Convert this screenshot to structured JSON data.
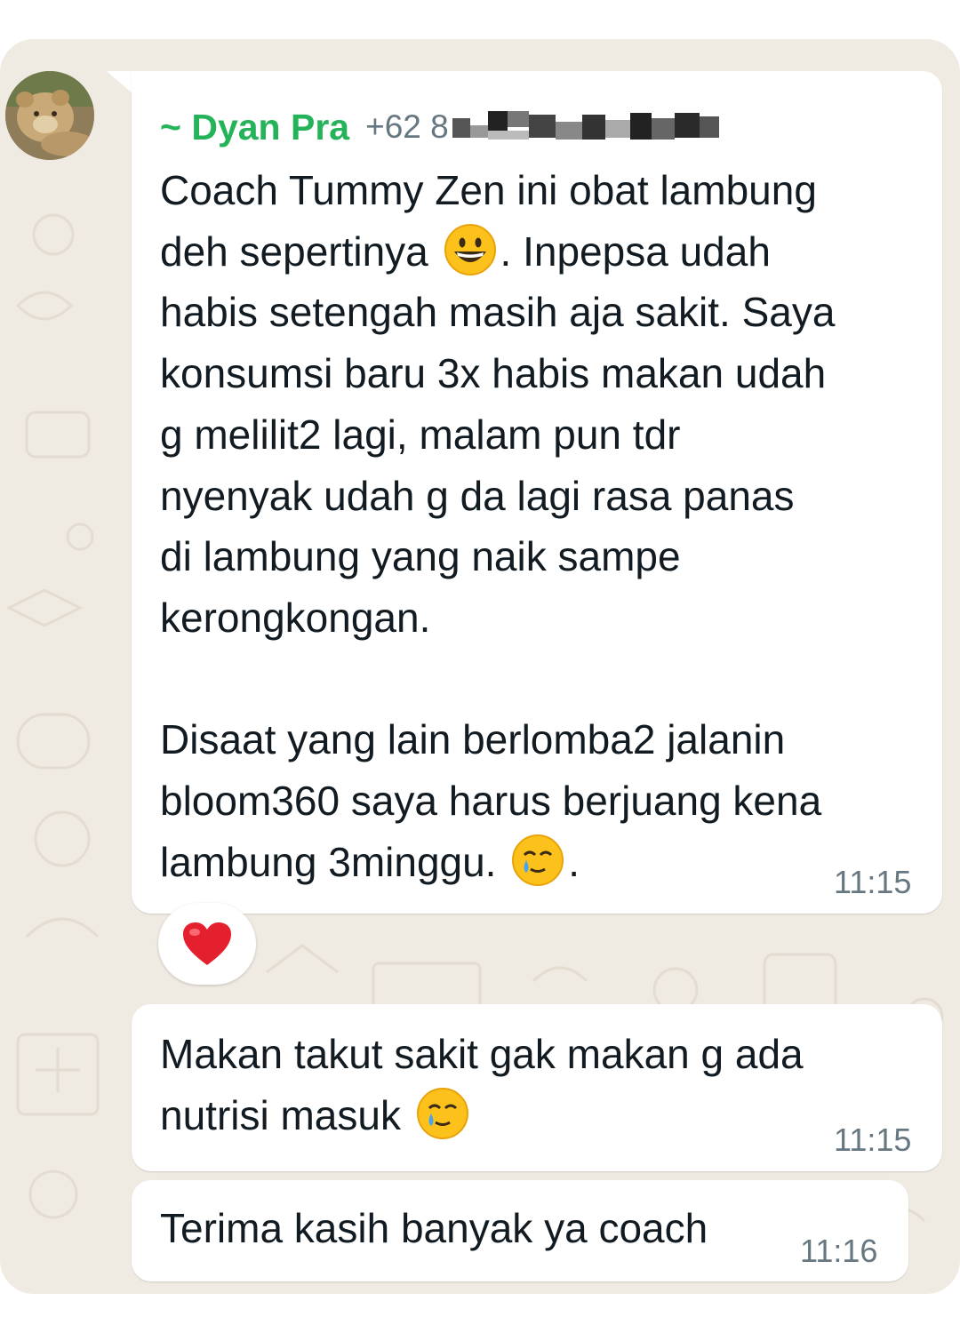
{
  "chat": {
    "message_1": {
      "sender_name": "~ Dyan Pra",
      "sender_phone": "+62 8",
      "text_part_1": "Coach Tummy Zen ini obat lambung\ndeh sepertinya ",
      "emoji_1": "grinning-face-emoji",
      "text_part_2": ". Inpepsa udah\nhabis setengah masih aja sakit. Saya\nkonsumsi baru 3x habis makan udah\ng melilit2 lagi, malam pun tdr\nnyenyak udah g da lagi rasa panas\ndi lambung yang naik sampe\nkerongkongan.\n\nDisaat yang lain berlomba2 jalanin\nbloom360 saya harus berjuang kena\nlambung 3minggu. ",
      "emoji_2": "smiling-face-with-tear-emoji",
      "text_part_3": ".",
      "time": "11:15",
      "reaction": "red-heart-emoji"
    },
    "message_2": {
      "text": "Makan takut sakit gak makan g ada\nnutrisi masuk ",
      "emoji": "smiling-face-with-tear-emoji",
      "time": "11:15"
    },
    "message_3": {
      "text": "Terima kasih banyak ya coach",
      "time": "11:16"
    }
  },
  "colors": {
    "sender_name": "#25b35a",
    "chat_background": "#efeae2",
    "bubble": "#ffffff",
    "time": "#667781",
    "text": "#111b21"
  }
}
